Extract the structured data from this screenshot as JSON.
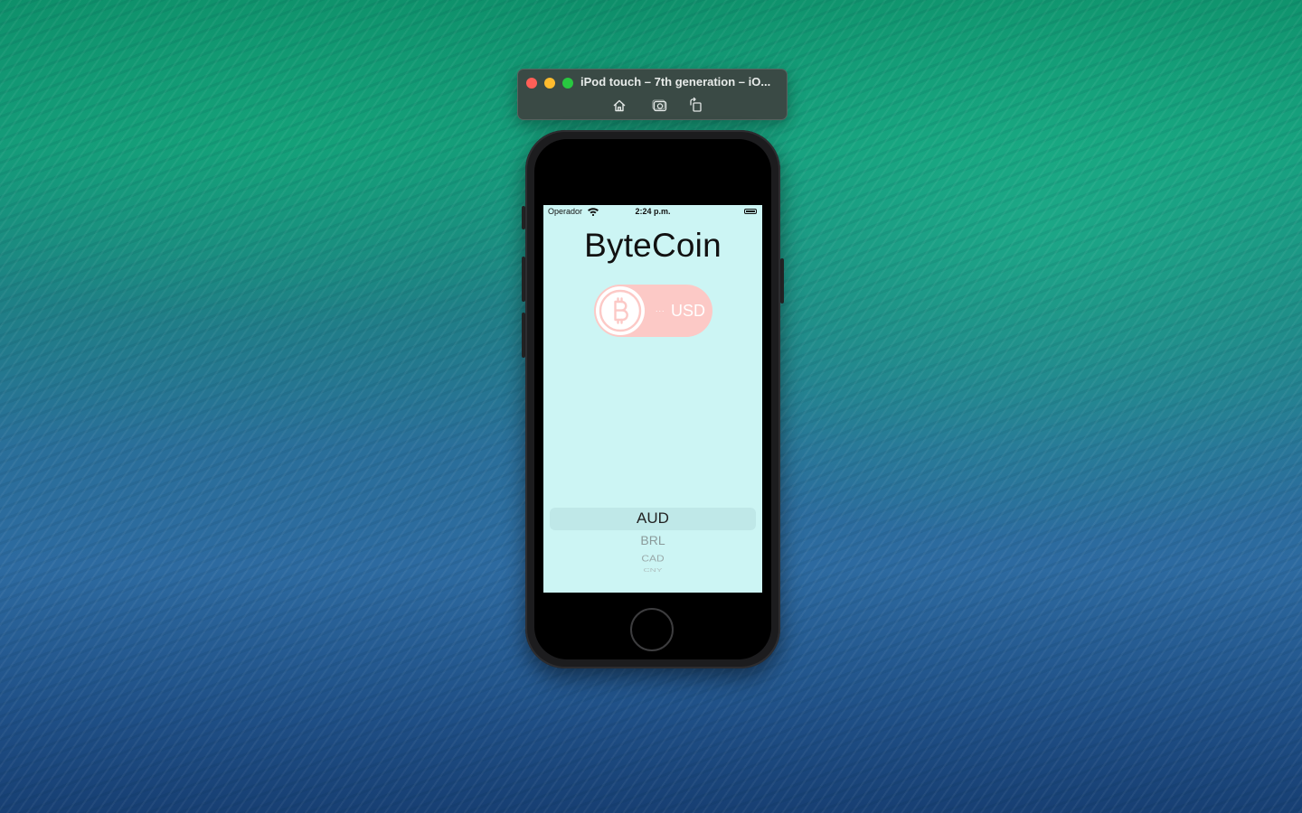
{
  "simulator": {
    "title": "iPod touch – 7th generation – iO...",
    "tools": [
      "home-icon",
      "screenshot-icon",
      "rotate-icon"
    ]
  },
  "status_bar": {
    "carrier": "Operador",
    "time": "2:24 p.m."
  },
  "app": {
    "title": "ByteCoin",
    "coin": {
      "icon": "bitcoin-icon",
      "value": "...",
      "currency": "USD"
    },
    "picker": {
      "options": [
        "AUD",
        "BRL",
        "CAD",
        "CNY"
      ],
      "selected": "AUD"
    }
  },
  "colors": {
    "screen_background": "#ccf5f4",
    "coin_pill": "#fcc9c6",
    "picker_selection": "#bfe8e8"
  }
}
